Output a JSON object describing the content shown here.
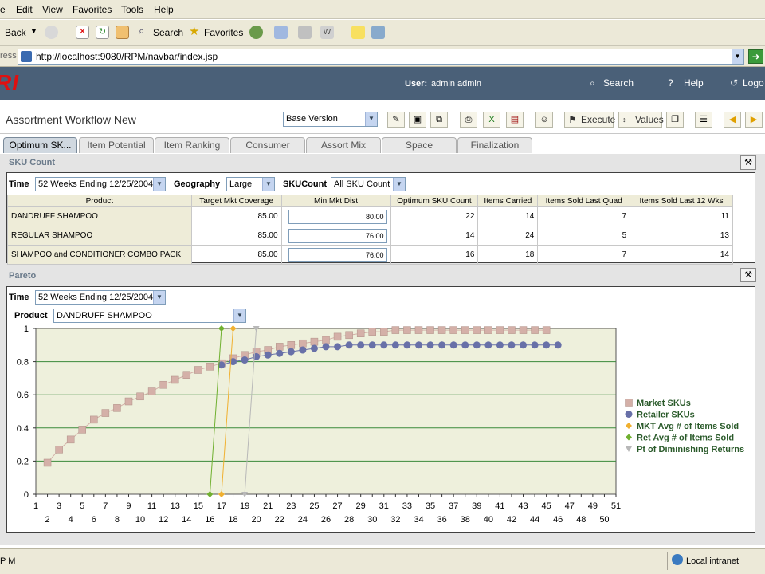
{
  "menu": [
    "e",
    "Edit",
    "View",
    "Favorites",
    "Tools",
    "Help"
  ],
  "toolbar": {
    "back": "Back",
    "search": "Search",
    "favorites": "Favorites"
  },
  "address": {
    "label": "ress",
    "url": "http://localhost:9080/RPM/navbar/index.jsp"
  },
  "header": {
    "logo": "RI",
    "user_label": "User:",
    "user_name": "admin admin",
    "search": "Search",
    "help": "Help",
    "logout": "Logo"
  },
  "page": {
    "title": "Assortment Workflow New",
    "version": "Base Version",
    "execute": "Execute",
    "values": "Values"
  },
  "tabs": [
    "Optimum SK...",
    "Item Potential",
    "Item Ranking",
    "Consumer",
    "Assort Mix",
    "Space",
    "Finalization"
  ],
  "sku": {
    "section": "SKU Count",
    "time_label": "Time",
    "time_value": "52 Weeks Ending 12/25/2004",
    "geo_label": "Geography",
    "geo_value": "Large",
    "skucount_label": "SKUCount",
    "skucount_value": "All SKU Count",
    "columns": [
      "Product",
      "Target Mkt Coverage",
      "Min Mkt Dist",
      "Optimum SKU Count",
      "Items Carried",
      "Items Sold Last Quad",
      "Items Sold Last 12 Wks"
    ],
    "rows": [
      [
        "DANDRUFF SHAMPOO",
        "85.00",
        "80.00",
        "22",
        "14",
        "7",
        "11"
      ],
      [
        "REGULAR SHAMPOO",
        "85.00",
        "76.00",
        "14",
        "24",
        "5",
        "13"
      ],
      [
        "SHAMPOO and CONDITIONER COMBO PACK",
        "85.00",
        "76.00",
        "16",
        "18",
        "7",
        "14"
      ]
    ]
  },
  "pareto": {
    "section": "Pareto",
    "time_label": "Time",
    "time_value": "52 Weeks Ending 12/25/2004",
    "product_label": "Product",
    "product_value": "DANDRUFF SHAMPOO"
  },
  "chart_data": {
    "type": "line",
    "xlim": [
      1,
      51
    ],
    "ylim": [
      0,
      1
    ],
    "x_ticks_top": [
      1,
      3,
      5,
      7,
      9,
      11,
      13,
      15,
      17,
      19,
      21,
      23,
      25,
      27,
      29,
      31,
      33,
      35,
      37,
      39,
      41,
      43,
      45,
      47,
      49,
      51
    ],
    "x_ticks_bottom": [
      2,
      4,
      6,
      8,
      10,
      12,
      14,
      16,
      18,
      20,
      22,
      24,
      26,
      28,
      30,
      32,
      34,
      36,
      38,
      40,
      42,
      44,
      46,
      48,
      50
    ],
    "y_ticks": [
      "0",
      "0.2",
      "0.4",
      "0.6",
      "0.8",
      "1"
    ],
    "legend_position": "right",
    "grid": true,
    "series": [
      {
        "name": "Market SKUs",
        "marker": "square",
        "color": "#d4b0a8",
        "x": [
          2,
          3,
          4,
          5,
          6,
          7,
          8,
          9,
          10,
          11,
          12,
          13,
          14,
          15,
          16,
          17,
          18,
          19,
          20,
          21,
          22,
          23,
          24,
          25,
          26,
          27,
          28,
          29,
          30,
          31,
          32,
          33,
          34,
          35,
          36,
          37,
          38,
          39,
          40,
          41,
          42,
          43,
          44,
          45
        ],
        "y": [
          0.19,
          0.27,
          0.33,
          0.39,
          0.45,
          0.49,
          0.52,
          0.56,
          0.59,
          0.62,
          0.66,
          0.69,
          0.72,
          0.75,
          0.77,
          0.79,
          0.82,
          0.84,
          0.86,
          0.87,
          0.89,
          0.9,
          0.91,
          0.92,
          0.93,
          0.95,
          0.96,
          0.97,
          0.98,
          0.98,
          0.99,
          0.99,
          0.99,
          0.99,
          0.99,
          0.99,
          0.99,
          0.99,
          0.99,
          0.99,
          0.99,
          0.99,
          0.99,
          0.99
        ]
      },
      {
        "name": "Retailer SKUs",
        "marker": "circle",
        "color": "#6870a8",
        "x": [
          17,
          18,
          19,
          20,
          21,
          22,
          23,
          24,
          25,
          26,
          27,
          28,
          29,
          30,
          31,
          32,
          33,
          34,
          35,
          36,
          37,
          38,
          39,
          40,
          41,
          42,
          43,
          44,
          45,
          46
        ],
        "y": [
          0.78,
          0.8,
          0.81,
          0.83,
          0.84,
          0.85,
          0.86,
          0.87,
          0.88,
          0.89,
          0.89,
          0.9,
          0.9,
          0.9,
          0.9,
          0.9,
          0.9,
          0.9,
          0.9,
          0.9,
          0.9,
          0.9,
          0.9,
          0.9,
          0.9,
          0.9,
          0.9,
          0.9,
          0.9,
          0.9
        ]
      },
      {
        "name": "MKT Avg # of Items Sold",
        "marker": "diamond",
        "color": "#f0b030",
        "x": [
          17,
          18
        ],
        "y": [
          0,
          1
        ]
      },
      {
        "name": "Ret Avg # of Items Sold",
        "marker": "diamond",
        "color": "#70b030",
        "x": [
          16,
          17
        ],
        "y": [
          0,
          1
        ]
      },
      {
        "name": "Pt of Diminishing Returns",
        "marker": "triangle",
        "color": "#b8b8b8",
        "x": [
          19,
          20
        ],
        "y": [
          0,
          1
        ]
      }
    ]
  },
  "status": {
    "left": "P M",
    "zone": "Local intranet"
  }
}
